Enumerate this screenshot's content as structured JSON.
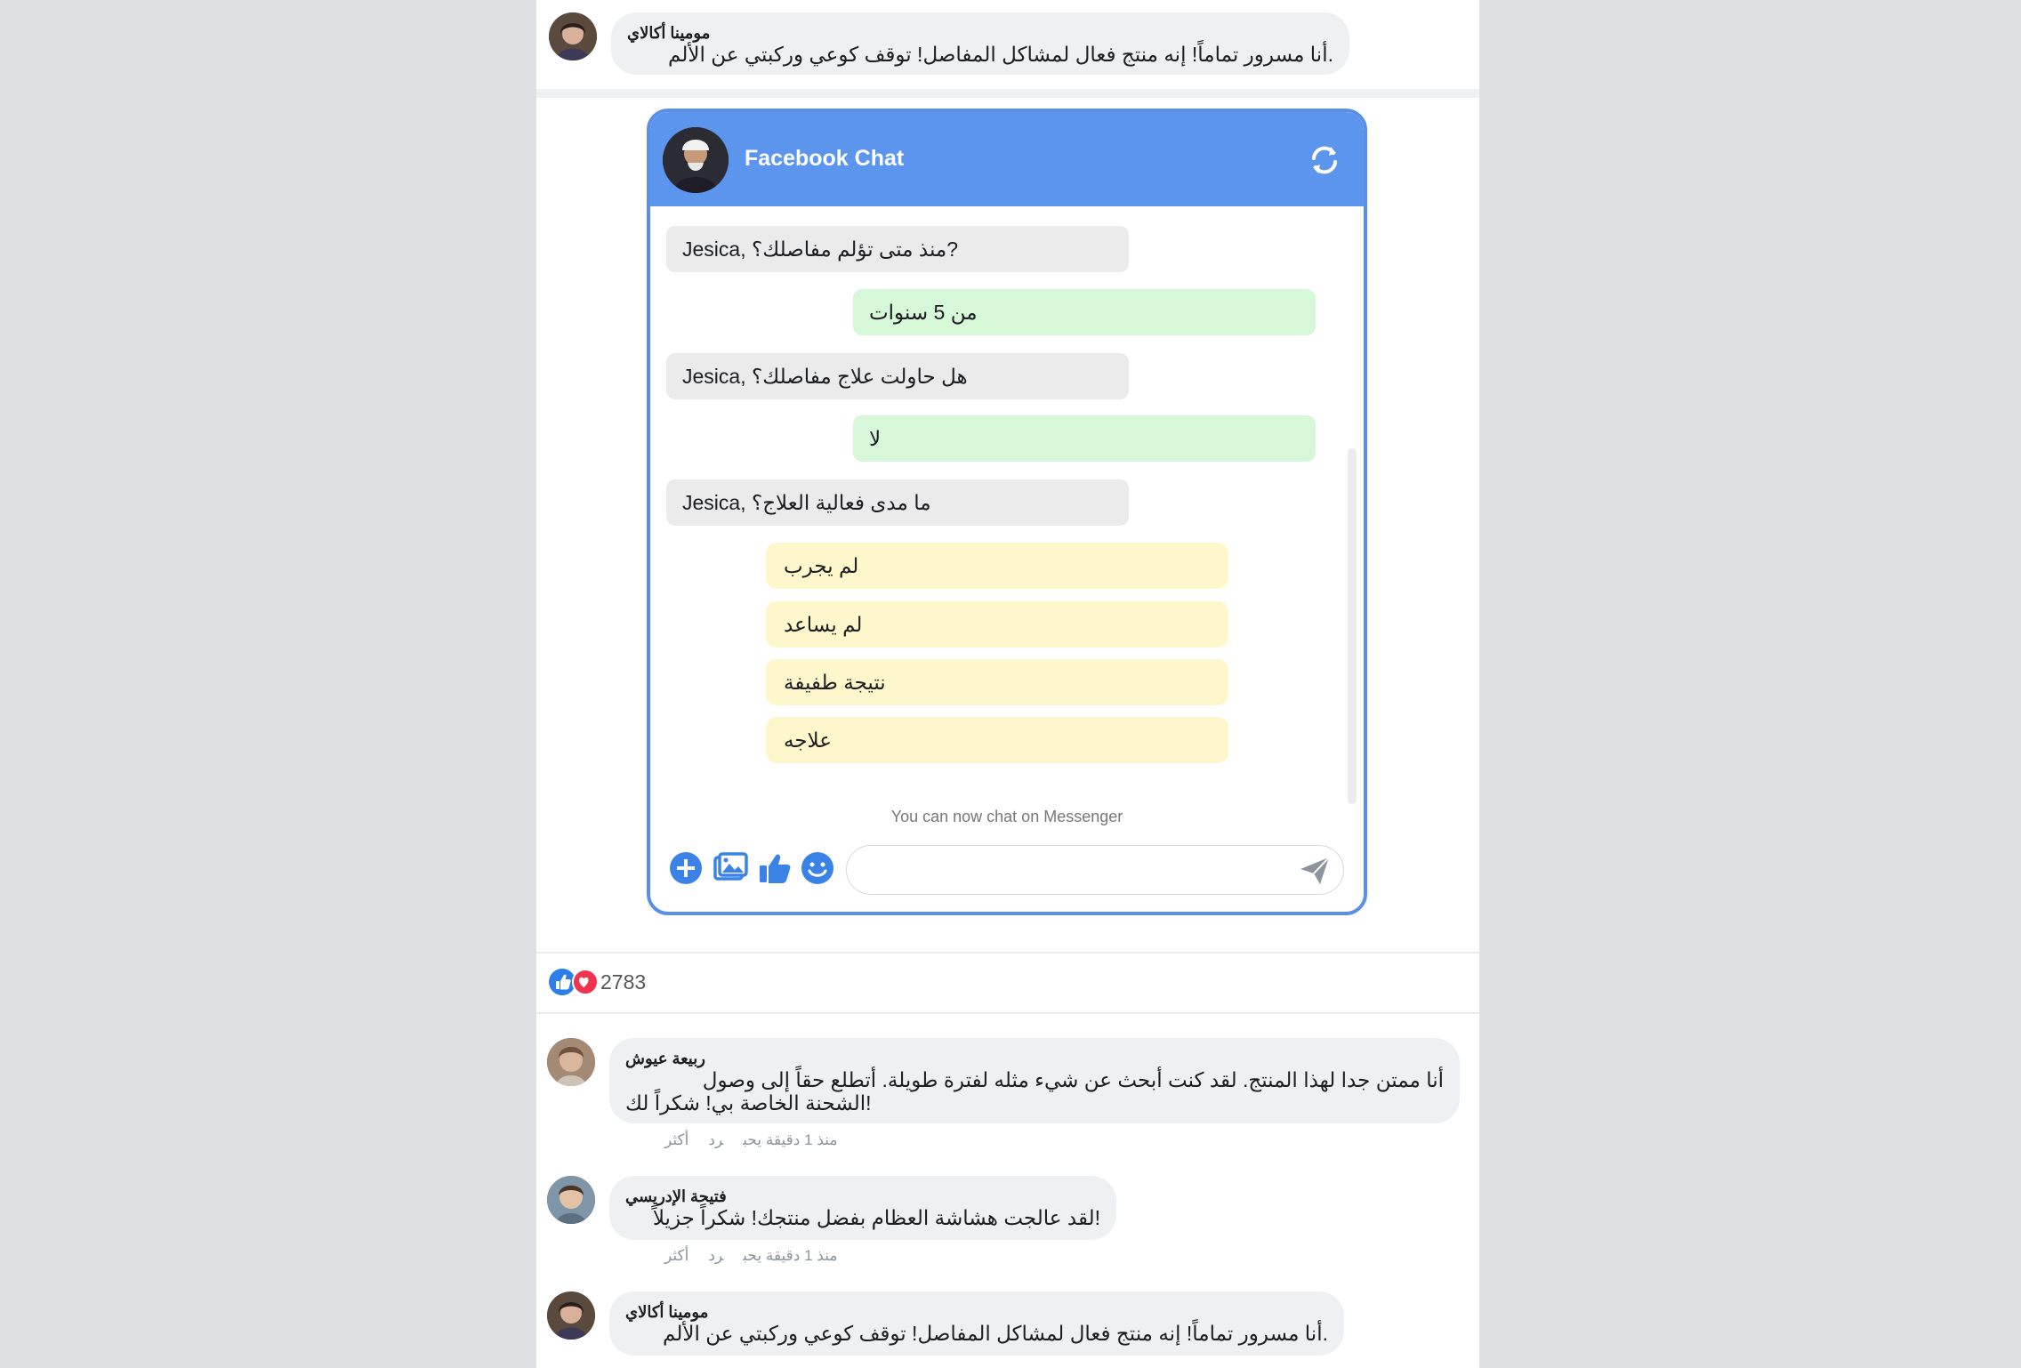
{
  "top_comment": {
    "author": "مومينا أكالاي",
    "text": ".أنا مسرور تماماً! إنه منتج فعال لمشاكل المفاصل! توقف كوعي وركبتي عن الألم"
  },
  "chat": {
    "title": "Facebook Chat",
    "messages": [
      {
        "from": "bot",
        "text": "?منذ متى تؤلم مفاصلك؟ ,Jesica"
      },
      {
        "from": "user",
        "text": "من 5 سنوات"
      },
      {
        "from": "bot",
        "text": "هل حاولت علاج مفاصلك؟ ,Jesica"
      },
      {
        "from": "user",
        "text": "لا"
      },
      {
        "from": "bot",
        "text": "ما مدى فعالية العلاج؟ ,Jesica"
      }
    ],
    "options": [
      "لم يجرب",
      "لم يساعد",
      "نتيجة طفيفة",
      "علاجه"
    ],
    "note": "You can now chat on Messenger",
    "input_placeholder": "",
    "icons": [
      "plus-icon",
      "image-icon",
      "thumbs-up-icon",
      "emoji-icon",
      "send-icon",
      "refresh-icon"
    ],
    "accent": "#5b95ee"
  },
  "reactions": {
    "count": "2783",
    "icons": [
      "like-icon",
      "heart-icon"
    ]
  },
  "comments": [
    {
      "author": "ربيعة عيوش",
      "line1": "أنا ممتن جدا لهذا المنتج. لقد كنت أبحث عن شيء مثله لفترة طويلة. أتطلع حقاً إلى وصول",
      "line2": "!الشحنة الخاصة بي! شكراً لك",
      "time": "منذ 1 دقيقة يحب",
      "reply": "رد",
      "more": "أكثر"
    },
    {
      "author": "فتيحة الإدريسي",
      "line1": "!لقد عالجت هشاشة العظام بفضل منتجك! شكراً جزيلاً",
      "time": "منذ 1 دقيقة يحب",
      "reply": "رد",
      "more": "أكثر"
    },
    {
      "author": "مومينا أكالاي",
      "line1": ".أنا مسرور تماماً! إنه منتج فعال لمشاكل المفاصل! توقف كوعي وركبتي عن الألم"
    }
  ]
}
